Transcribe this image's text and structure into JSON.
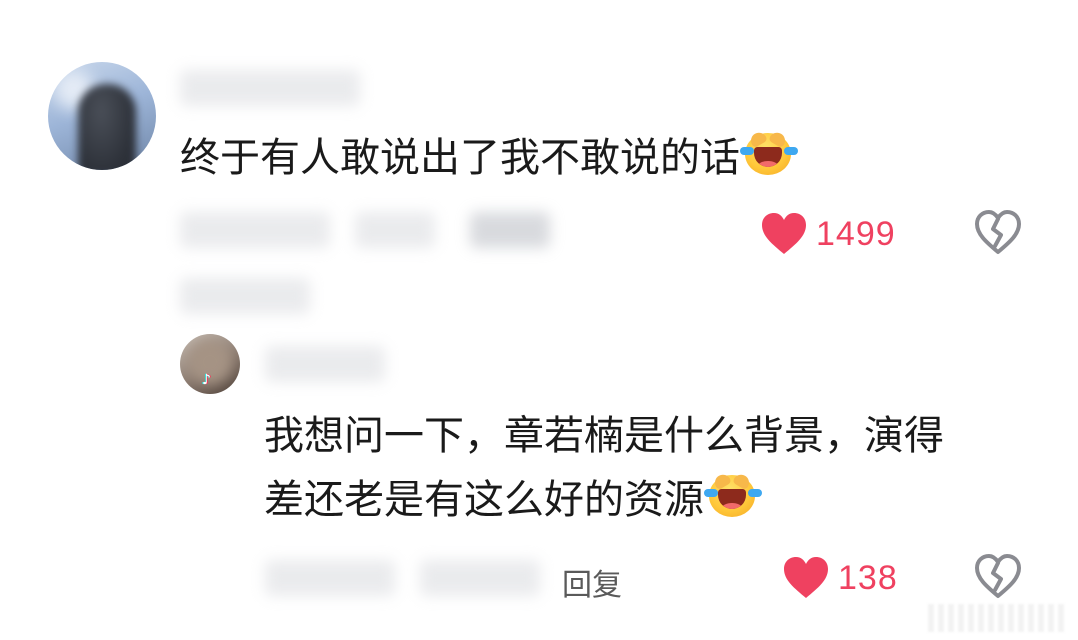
{
  "comments": {
    "main": {
      "text": "终于有人敢说出了我不敢说的话",
      "emoji": "crying-laughing-emoji",
      "like_count": "1499"
    },
    "reply": {
      "line1": "我想问一下，章若楠是什么背景，演得",
      "line2": "差还老是有这么好的资源",
      "emoji": "crying-laughing-emoji",
      "like_count": "138",
      "reply_label": "回复"
    }
  },
  "icons": {
    "like": "heart-icon",
    "dislike": "broken-heart-icon"
  },
  "colors": {
    "like": "#ef4160",
    "dislike": "#8a8b91",
    "text": "#1a1a1a"
  }
}
